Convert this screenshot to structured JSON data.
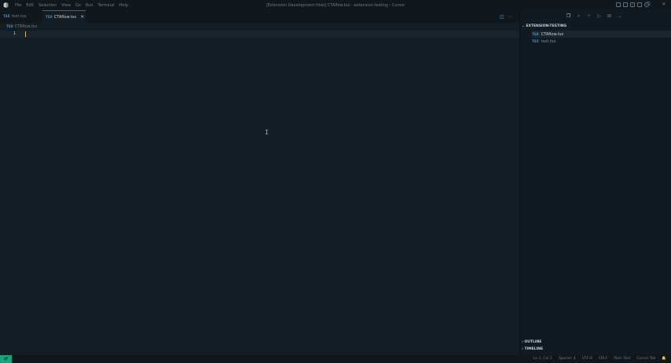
{
  "window": {
    "title": "[Extension Development Host] CTAflow.tsx - extension-testing - Cursor",
    "menu": [
      "File",
      "Edit",
      "Selection",
      "View",
      "Go",
      "Run",
      "Terminal",
      "Help"
    ]
  },
  "tabs": [
    {
      "ext": "TSX",
      "label": "test.tsx"
    },
    {
      "ext": "TSX",
      "label": "CTAflow.tsx",
      "close": "✕"
    }
  ],
  "breadcrumb": {
    "ext": "TSX",
    "label": "CTAflow.tsx"
  },
  "editor": {
    "line_number": "1"
  },
  "explorer": {
    "section_title": "EXTENSION-TESTING",
    "files": [
      {
        "ext": "TSX",
        "label": "CTAflow.tsx"
      },
      {
        "ext": "TSX",
        "label": "test.tsx"
      }
    ],
    "outline": "OUTLINE",
    "timeline": "TIMELINE"
  },
  "statusbar": {
    "remote_icon": "⇄",
    "items": [
      "Ln 1, Col 1",
      "Spaces: 4",
      "UTF-8",
      "CRLF",
      "Plain Text",
      "Cursor Tab",
      "🔔"
    ]
  }
}
